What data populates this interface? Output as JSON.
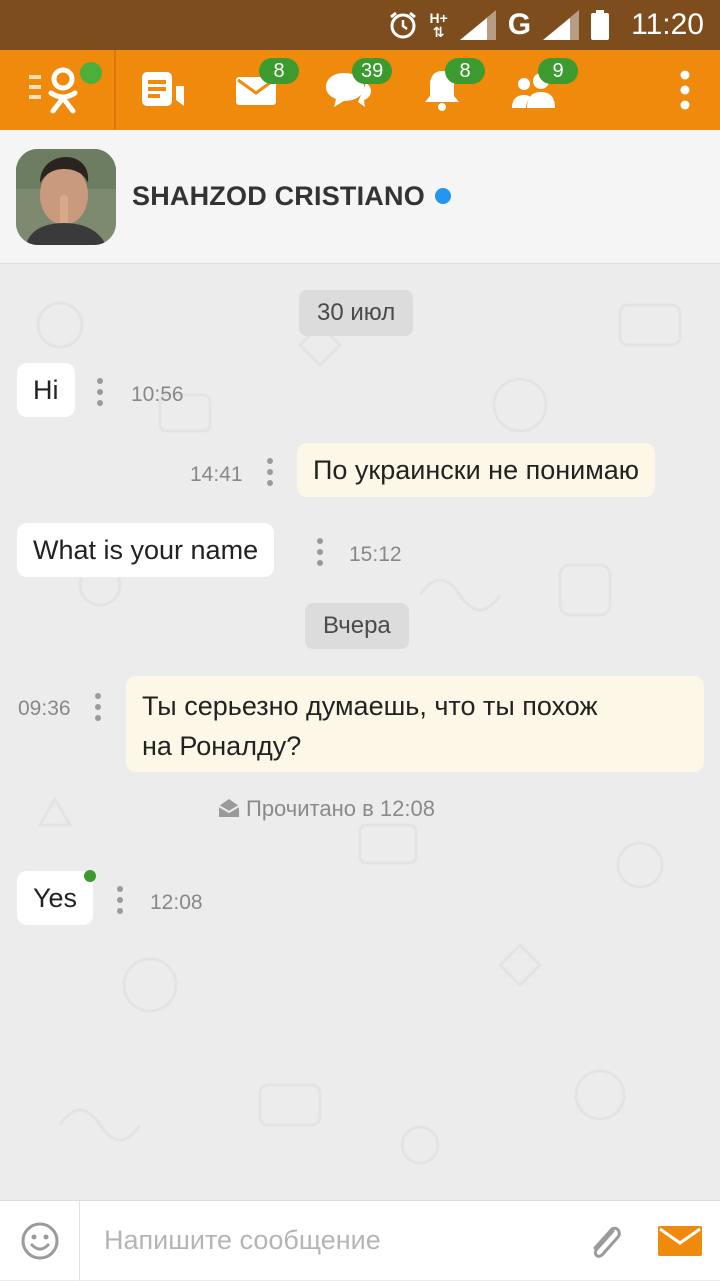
{
  "status_bar": {
    "network_label": "H+",
    "network_type": "G",
    "time": "11:20",
    "icons": [
      "alarm-icon",
      "signal-icon",
      "signal-icon",
      "battery-icon"
    ]
  },
  "toolbar": {
    "badges": {
      "messages": "8",
      "discussions": "39",
      "notifications": "8",
      "friends": "9"
    },
    "accent_color": "#f08a0c",
    "badge_color": "#3c9b2f"
  },
  "contact": {
    "name": "SHAHZOD CRISTIANO",
    "online_color": "#2196f3"
  },
  "chat": {
    "date_1": "30 июл",
    "date_2": "Вчера",
    "messages": [
      {
        "text": "Hi",
        "time": "10:56",
        "direction": "in"
      },
      {
        "text": "По украински не понимаю",
        "time": "14:41",
        "direction": "out"
      },
      {
        "text": "What is your name",
        "time": "15:12",
        "direction": "in"
      },
      {
        "text_line1": "Ты серьезно думаешь,  что ты похож",
        "text_line2": "на Роналду?",
        "time": "09:36",
        "direction": "out"
      },
      {
        "text": "Yes",
        "time": "12:08",
        "direction": "in"
      }
    ],
    "read_status": "Прочитано в 12:08"
  },
  "input": {
    "placeholder": "Напишите сообщение"
  }
}
